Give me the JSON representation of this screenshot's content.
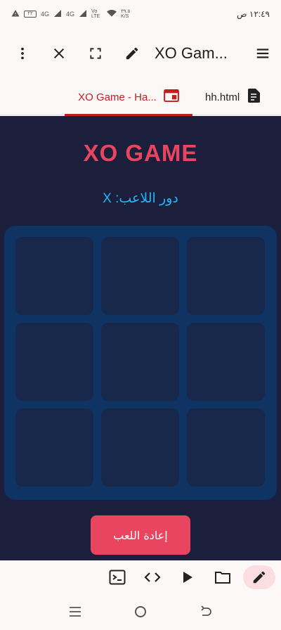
{
  "status_bar": {
    "time": "١٢:٤٩ ص",
    "net1": "4G",
    "net2": "4G",
    "volte": "Vo LTE",
    "speed": "٣٩.٥ K/S",
    "battery": "٢٢"
  },
  "toolbar": {
    "title": "XO Game - Ha...",
    "title_display": "XO Gam..."
  },
  "tabs": [
    {
      "label": "XO Game - Ha...",
      "active": true
    },
    {
      "label": "hh.html",
      "active": false
    }
  ],
  "game": {
    "title": "XO GAME",
    "turn_text": "دور اللاعب: X",
    "cells": [
      "",
      "",
      "",
      "",
      "",
      "",
      "",
      "",
      ""
    ],
    "reset_label": "إعادة اللعب"
  },
  "colors": {
    "accent": "#e94560",
    "turn": "#1fb6ff",
    "background": "#1b1f3b",
    "board": "#0f3463",
    "cell": "#17284b",
    "tab_active": "#c41d1d"
  },
  "bottom_bar": {
    "icons": [
      "terminal-icon",
      "code-icon",
      "play-icon",
      "folder-icon",
      "pencil-icon"
    ]
  },
  "nav_bar": {
    "icons": [
      "menu-icon",
      "home-icon",
      "back-icon"
    ]
  }
}
